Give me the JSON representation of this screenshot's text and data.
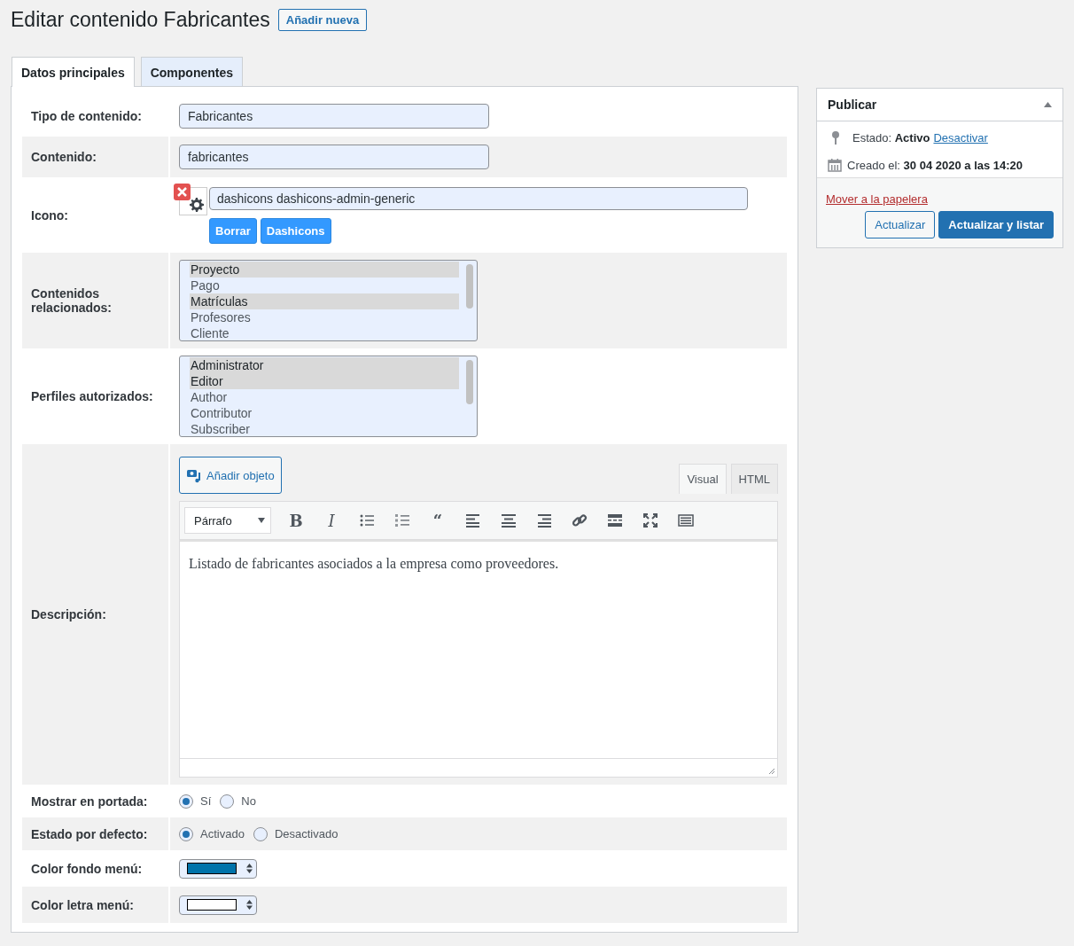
{
  "header": {
    "title": "Editar contenido Fabricantes",
    "add_new": "Añadir nueva"
  },
  "tabs": [
    {
      "label": "Datos principales",
      "selected": true
    },
    {
      "label": "Componentes",
      "selected": false
    }
  ],
  "fields": [
    {
      "kind": "text",
      "label": "Tipo de contenido:",
      "value": "Fabricantes"
    },
    {
      "kind": "text",
      "label": "Contenido:",
      "value": "fabricantes"
    },
    {
      "kind": "icon",
      "label": "Icono:",
      "value": "dashicons dashicons-admin-generic",
      "buttons": [
        "Borrar",
        "Dashicons"
      ]
    },
    {
      "kind": "multiselect",
      "label": "Contenidos relacionados:",
      "options": [
        {
          "label": "Proyecto",
          "selected": true
        },
        {
          "label": "Pago",
          "selected": false
        },
        {
          "label": "Matrículas",
          "selected": true
        },
        {
          "label": "Profesores",
          "selected": false
        },
        {
          "label": "Cliente",
          "selected": false
        }
      ]
    },
    {
      "kind": "multiselect",
      "label": "Perfiles autorizados:",
      "options": [
        {
          "label": "Administrator",
          "selected": true
        },
        {
          "label": "Editor",
          "selected": true
        },
        {
          "label": "Author",
          "selected": false
        },
        {
          "label": "Contributor",
          "selected": false
        },
        {
          "label": "Subscriber",
          "selected": false
        }
      ]
    },
    {
      "kind": "editor",
      "label": "Descripción:",
      "media_button": "Añadir objeto",
      "modes": [
        {
          "label": "Visual",
          "selected": true
        },
        {
          "label": "HTML",
          "selected": false
        }
      ],
      "format": "Párrafo",
      "toolbar": [
        {
          "kind": "bold",
          "glyph": "B"
        },
        {
          "kind": "italic",
          "glyph": "I"
        },
        {
          "kind": "bullets"
        },
        {
          "kind": "numbers"
        },
        {
          "kind": "quote",
          "glyph": "“"
        },
        {
          "kind": "align-left"
        },
        {
          "kind": "align-center"
        },
        {
          "kind": "align-right"
        },
        {
          "kind": "link"
        },
        {
          "kind": "more"
        },
        {
          "kind": "fullscreen"
        },
        {
          "kind": "keyboard"
        }
      ],
      "content": "Listado de fabricantes asociados a la empresa como proveedores."
    },
    {
      "kind": "radio",
      "label": "Mostrar en portada:",
      "options": [
        {
          "label": "Sí",
          "selected": true
        },
        {
          "label": "No",
          "selected": false
        }
      ]
    },
    {
      "kind": "radio",
      "label": "Estado por defecto:",
      "options": [
        {
          "label": "Activado",
          "selected": true
        },
        {
          "label": "Desactivado",
          "selected": false
        }
      ]
    },
    {
      "kind": "color",
      "label": "Color fondo menú:",
      "color": "#0073aa"
    },
    {
      "kind": "color",
      "label": "Color letra menú:",
      "color": "#ffffff"
    }
  ],
  "publish": {
    "title": "Publicar",
    "status_label": "Estado:",
    "status": "Activo",
    "status_link": "Desactivar",
    "created_label": "Creado el:",
    "created": "30 04 2020 a las 14:20",
    "trash": "Mover a la papelera",
    "buttons": [
      {
        "label": "Actualizar",
        "kind": "secondary"
      },
      {
        "label": "Actualizar y listar",
        "kind": "primary"
      }
    ]
  }
}
